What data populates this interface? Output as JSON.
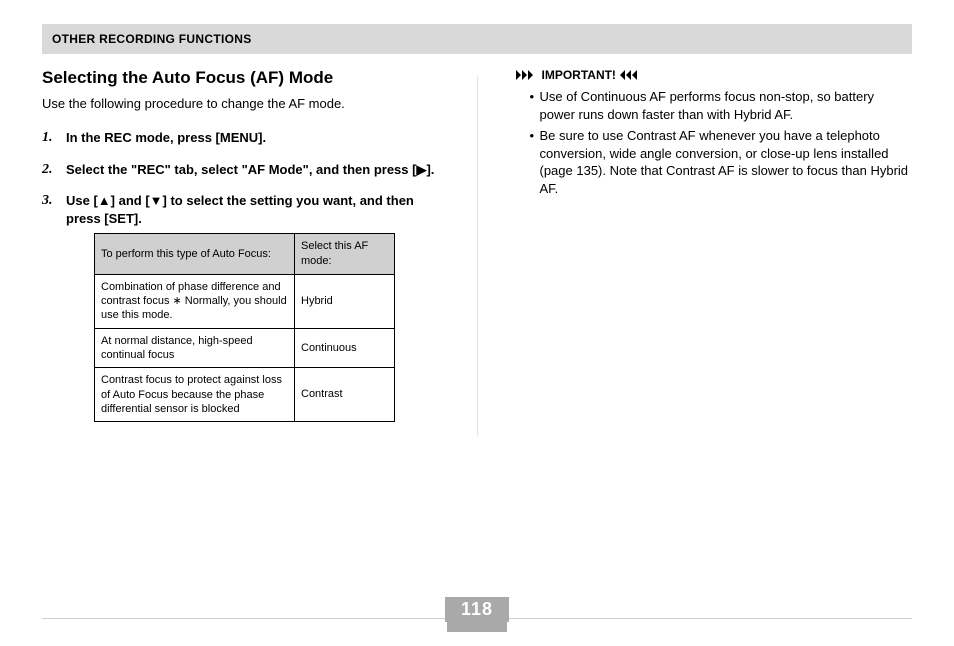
{
  "header": {
    "title": "OTHER RECORDING FUNCTIONS"
  },
  "left": {
    "heading": "Selecting the Auto Focus (AF) Mode",
    "intro": "Use the following procedure to change the AF mode.",
    "steps": [
      {
        "num": "1.",
        "text": "In the REC mode, press [MENU]."
      },
      {
        "num": "2.",
        "text": "Select the \"REC\" tab, select \"AF Mode\", and then press [▶]."
      },
      {
        "num": "3.",
        "text": "Use [▲] and [▼] to select the setting you want, and then press [SET]."
      }
    ],
    "table": {
      "head_left": "To perform this type of Auto Focus:",
      "head_right": "Select this AF mode:",
      "rows": [
        {
          "left": "Combination of phase difference and contrast focus\n∗ Normally, you should use this mode.",
          "right": "Hybrid"
        },
        {
          "left": "At normal distance, high-speed continual focus",
          "right": "Continuous"
        },
        {
          "left": "Contrast focus to protect against loss of Auto Focus because the phase differential sensor is blocked",
          "right": "Contrast"
        }
      ]
    }
  },
  "right": {
    "important_label": "IMPORTANT!",
    "bullets": [
      "Use of Continuous AF performs focus non-stop, so battery power runs down faster than with Hybrid AF.",
      "Be sure to use Contrast AF whenever you have a telephoto conversion, wide angle conversion, or close-up lens installed (page 135). Note that Contrast AF is slower to focus than Hybrid AF."
    ]
  },
  "page_number": "118"
}
